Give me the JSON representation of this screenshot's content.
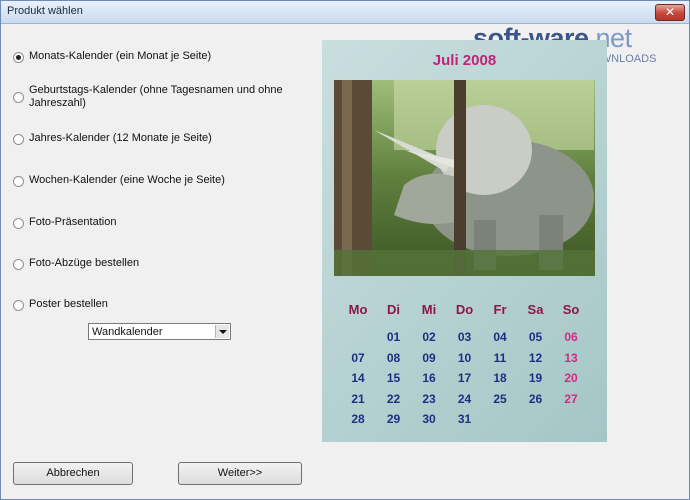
{
  "window": {
    "title": "Produkt wählen",
    "close_label": "✕"
  },
  "watermark": {
    "main": "soft-ware",
    "tld": ".net",
    "sub": "AKTUELLE DOWNLOADS"
  },
  "options": [
    {
      "label": "Monats-Kalender (ein Monat je Seite)",
      "checked": true
    },
    {
      "label": "Geburtstags-Kalender (ohne Tagesnamen und ohne Jahreszahl)",
      "checked": false
    },
    {
      "label": "Jahres-Kalender (12 Monate je Seite)",
      "checked": false
    },
    {
      "label": "Wochen-Kalender (eine Woche je Seite)",
      "checked": false
    },
    {
      "label": "Foto-Präsentation",
      "checked": false
    },
    {
      "label": "Foto-Abzüge bestellen",
      "checked": false
    },
    {
      "label": "Poster bestellen",
      "checked": false
    }
  ],
  "format_select": {
    "value": "Wandkalender"
  },
  "preview": {
    "month_title": "Juli 2008",
    "weekdays": [
      "Mo",
      "Di",
      "Mi",
      "Do",
      "Fr",
      "Sa",
      "So"
    ],
    "weeks": [
      [
        "",
        "01",
        "02",
        "03",
        "04",
        "05",
        "06"
      ],
      [
        "07",
        "08",
        "09",
        "10",
        "11",
        "12",
        "13"
      ],
      [
        "14",
        "15",
        "16",
        "17",
        "18",
        "19",
        "20"
      ],
      [
        "21",
        "22",
        "23",
        "24",
        "25",
        "26",
        "27"
      ],
      [
        "28",
        "29",
        "30",
        "31",
        "",
        "",
        ""
      ]
    ],
    "colors": {
      "title": "#c2227a",
      "weekday": "#8a1846",
      "date": "#1d2f83",
      "sunday": "#d02c82"
    }
  },
  "buttons": {
    "cancel": "Abbrechen",
    "next": "Weiter>>"
  }
}
